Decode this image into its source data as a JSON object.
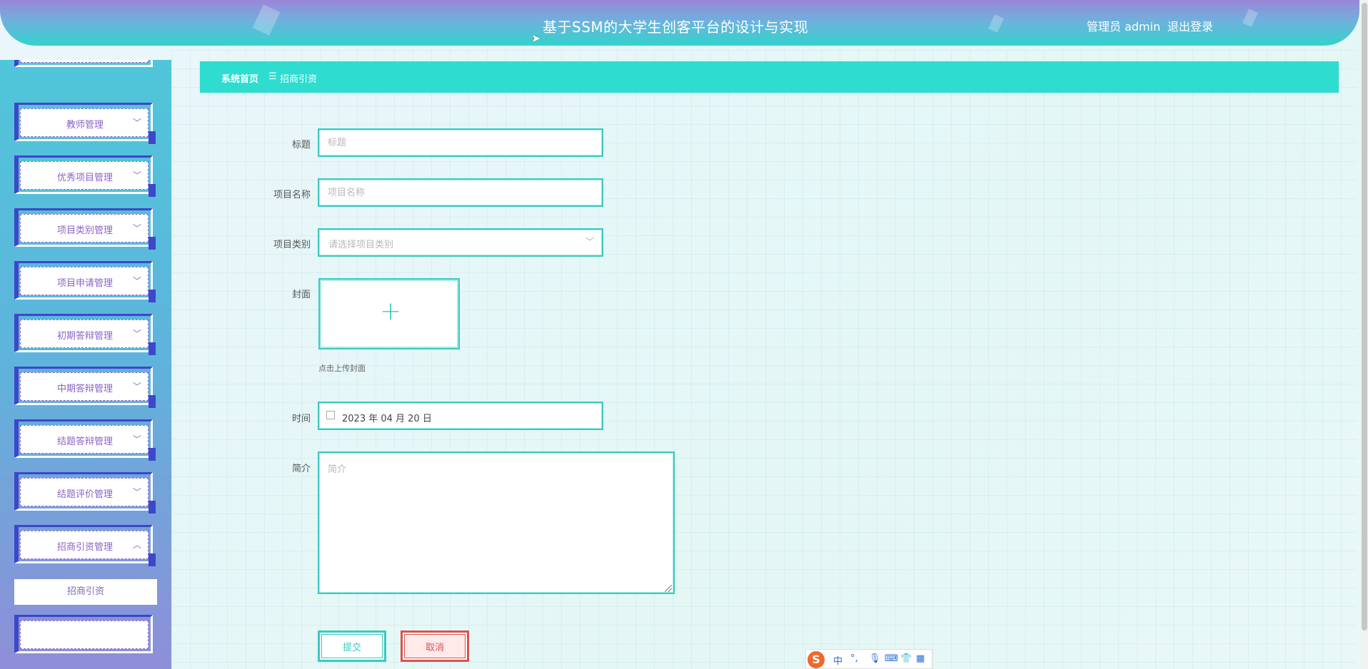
{
  "header": {
    "title": "基于SSM的大学生创客平台的设计与实现",
    "user_label": "管理员 admin",
    "logout_label": "退出登录"
  },
  "sidebar": {
    "items": [
      {
        "label": "教师管理",
        "expanded": false
      },
      {
        "label": "优秀项目管理",
        "expanded": false
      },
      {
        "label": "项目类别管理",
        "expanded": false
      },
      {
        "label": "项目申请管理",
        "expanded": false
      },
      {
        "label": "初期答辩管理",
        "expanded": false
      },
      {
        "label": "中期答辩管理",
        "expanded": false
      },
      {
        "label": "结题答辩管理",
        "expanded": false
      },
      {
        "label": "结题评价管理",
        "expanded": false
      },
      {
        "label": "招商引资管理",
        "expanded": true
      }
    ],
    "submenu_item": "招商引资"
  },
  "breadcrumb": {
    "home": "系统首页",
    "separator": "☰",
    "current": "招商引资"
  },
  "form": {
    "title": {
      "label": "标题",
      "placeholder": "标题",
      "value": ""
    },
    "project_name": {
      "label": "项目名称",
      "placeholder": "项目名称",
      "value": ""
    },
    "project_category": {
      "label": "项目类别",
      "placeholder": "请选择项目类别"
    },
    "cover": {
      "label": "封面",
      "hint": "点击上传封面"
    },
    "time": {
      "label": "时间",
      "value": "2023 年 04 月 20 日"
    },
    "intro": {
      "label": "简介",
      "placeholder": "简介",
      "value": ""
    },
    "submit_label": "提交",
    "cancel_label": "取消"
  },
  "ime": {
    "logo": "S",
    "mode": "中",
    "punct": "°,"
  },
  "colors": {
    "accent": "#2edcd0",
    "sidebar_frame": "#3d47c9",
    "menu_text": "#8a63c4",
    "cancel": "#d9534f"
  }
}
